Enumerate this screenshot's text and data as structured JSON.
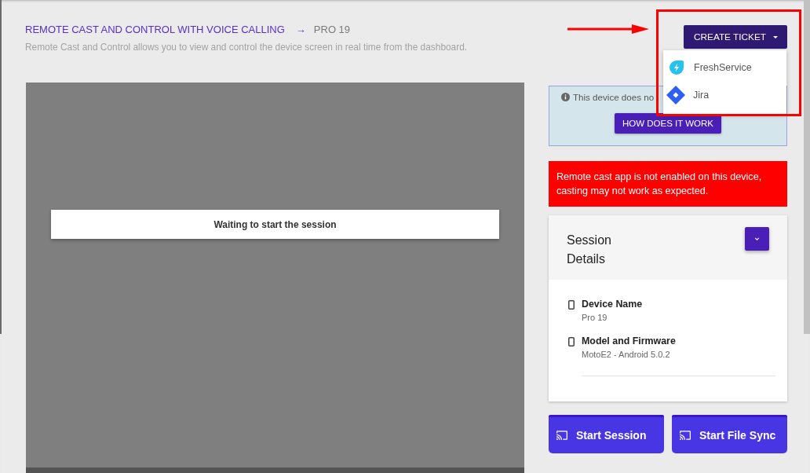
{
  "header": {
    "title": "REMOTE CAST AND CONTROL WITH VOICE CALLING",
    "separator": "→",
    "device": "PRO 19",
    "description": "Remote Cast and Control allows you to view and control the device screen in real time from the dashboard."
  },
  "ticket_button": {
    "label": "CREATE TICKET",
    "expanded": true
  },
  "ticket_menu": [
    {
      "label": "FreshService",
      "kind": "freshservice"
    },
    {
      "label": "Jira",
      "kind": "jira"
    }
  ],
  "cast_screen": {
    "status": "Waiting to start the session"
  },
  "info_notice": {
    "text": "This device does no",
    "button": "HOW DOES IT WORK"
  },
  "warning": "Remote cast app is not enabled on this device, casting may not work as expected.",
  "session_details": {
    "title": "Session Details",
    "fields": [
      {
        "label": "Device Name",
        "value": "Pro 19"
      },
      {
        "label": "Model and Firmware",
        "value": "MotoE2 - Android 5.0.2"
      }
    ]
  },
  "actions": [
    {
      "label": "Start Session"
    },
    {
      "label": "Start File Sync"
    }
  ],
  "annotation": {
    "arrow": true,
    "highlight_frame": true
  }
}
